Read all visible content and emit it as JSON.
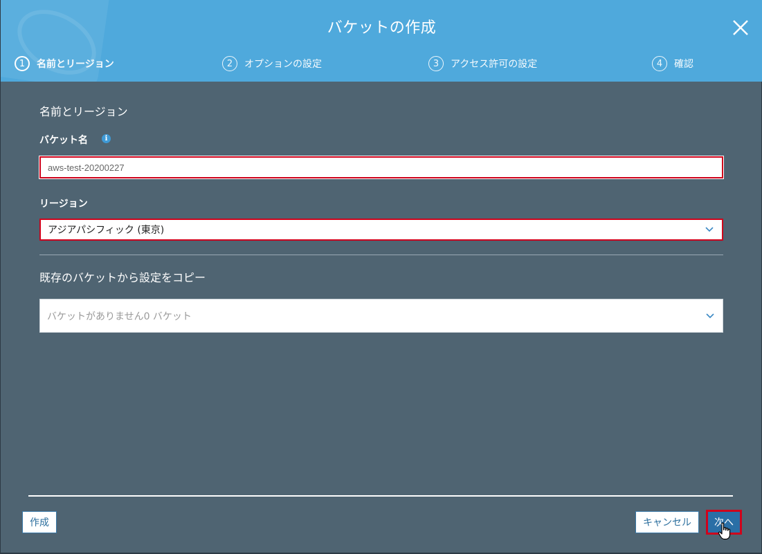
{
  "dialog": {
    "title": "バケットの作成",
    "close_icon": "close-icon"
  },
  "steps": [
    {
      "number": "1",
      "label": "名前とリージョン",
      "active": true
    },
    {
      "number": "2",
      "label": "オプションの設定",
      "active": false
    },
    {
      "number": "3",
      "label": "アクセス許可の設定",
      "active": false
    },
    {
      "number": "4",
      "label": "確認",
      "active": false
    }
  ],
  "form": {
    "section_title": "名前とリージョン",
    "bucket_name_label": "バケット名",
    "bucket_name_value": "aws-test-20200227",
    "info_icon": "info-icon",
    "region_label": "リージョン",
    "region_value": "アジアパシフィック (東京)",
    "copy_title": "既存のバケットから設定をコピー",
    "copy_placeholder": "バケットがありません0 バケット"
  },
  "footer": {
    "create_label": "作成",
    "cancel_label": "キャンセル",
    "next_label": "次へ"
  },
  "colors": {
    "header": "#4fa9dc",
    "body": "#4f6472",
    "highlight": "#d0021b",
    "primary_button": "#2a6fa6"
  }
}
